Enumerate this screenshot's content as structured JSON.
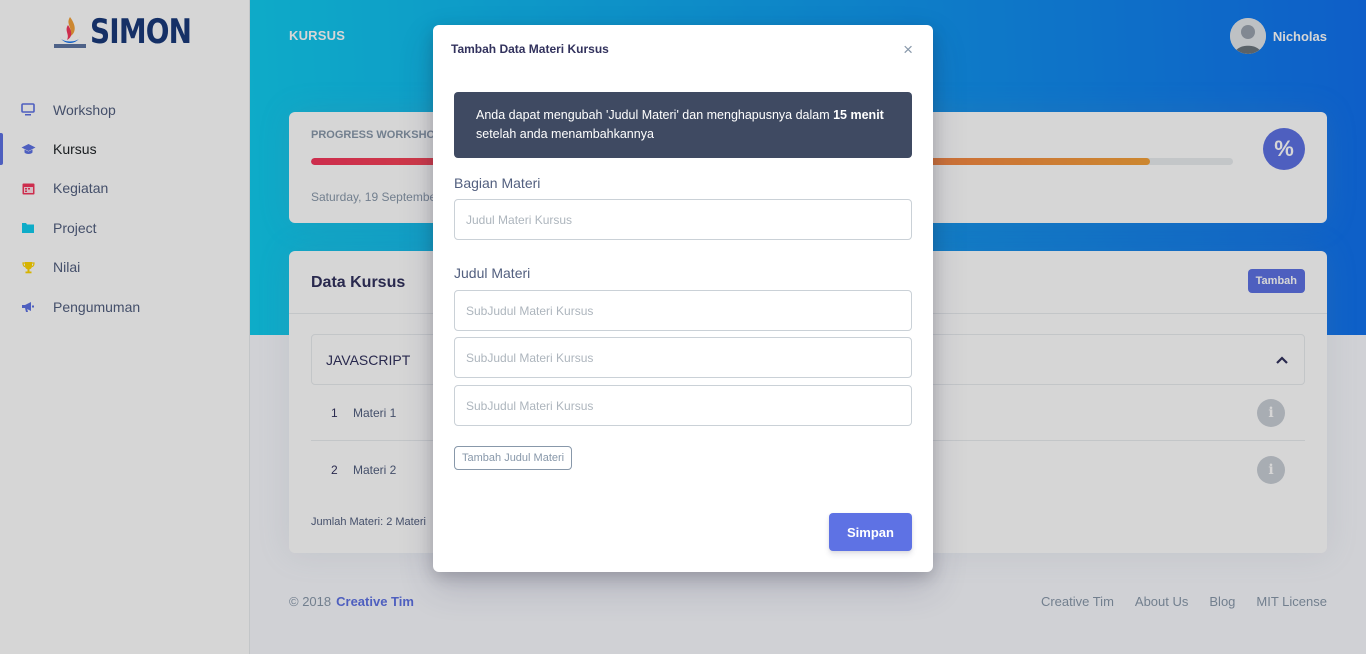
{
  "app": {
    "logo_text": "SIMON"
  },
  "sidebar": {
    "items": [
      {
        "label": "Workshop",
        "icon": "monitor-icon",
        "color": "#5e72e4"
      },
      {
        "label": "Kursus",
        "icon": "graduation-cap-icon",
        "color": "#5e72e4",
        "active": true
      },
      {
        "label": "Kegiatan",
        "icon": "calendar-icon",
        "color": "#f5365c"
      },
      {
        "label": "Project",
        "icon": "folder-icon",
        "color": "#11cdef"
      },
      {
        "label": "Nilai",
        "icon": "trophy-icon",
        "color": "#ffd600"
      },
      {
        "label": "Pengumuman",
        "icon": "megaphone-icon",
        "color": "#5e72e4"
      }
    ]
  },
  "header": {
    "title": "KURSUS",
    "user_name": "Nicholas"
  },
  "progress": {
    "title": "PROGRESS WORKSHOP",
    "date": "Saturday, 19 September",
    "percent": 91
  },
  "data_kursus": {
    "title": "Data Kursus",
    "add_label": "Tambah",
    "section": "JAVASCRIPT",
    "rows": [
      {
        "num": "1",
        "label": "Materi 1"
      },
      {
        "num": "2",
        "label": "Materi 2"
      }
    ],
    "total": "Jumlah Materi: 2 Materi"
  },
  "footer": {
    "copyright": "© 2018",
    "brand": "Creative Tim",
    "links": [
      "Creative Tim",
      "About Us",
      "Blog",
      "MIT License"
    ]
  },
  "modal": {
    "title": "Tambah Data Materi Kursus",
    "close": "×",
    "alert_pre": "Anda dapat mengubah 'Judul Materi' dan menghapusnya dalam ",
    "alert_bold": "15 menit",
    "alert_post": " setelah anda menambahkannya",
    "bagian_label": "Bagian Materi",
    "bagian_placeholder": "Judul Materi Kursus",
    "judul_label": "Judul Materi",
    "sub_placeholders": [
      "SubJudul Materi Kursus",
      "SubJudul Materi Kursus",
      "SubJudul Materi Kursus"
    ],
    "add_sub_label": "Tambah Judul Materi",
    "save_label": "Simpan"
  }
}
